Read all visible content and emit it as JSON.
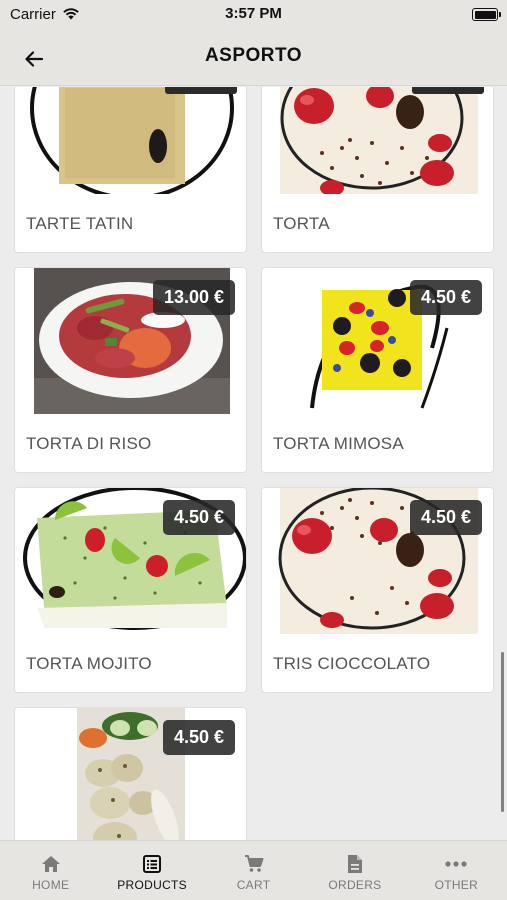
{
  "status_bar": {
    "carrier": "Carrier",
    "time": "3:57 PM"
  },
  "header": {
    "title": "ASPORTO"
  },
  "products": [
    {
      "name": "TARTE TATIN",
      "price": ""
    },
    {
      "name": "TORTA",
      "price": ""
    },
    {
      "name": "TORTA DI RISO",
      "price": "13.00 €"
    },
    {
      "name": "TORTA MIMOSA",
      "price": "4.50 €"
    },
    {
      "name": "TORTA MOJITO",
      "price": "4.50 €"
    },
    {
      "name": "TRIS CIOCCOLATO",
      "price": "4.50 €"
    },
    {
      "name": "",
      "price": "4.50 €"
    }
  ],
  "tabs": [
    {
      "label": "HOME",
      "icon": "home-icon",
      "active": false
    },
    {
      "label": "PRODUCTS",
      "icon": "list-icon",
      "active": true
    },
    {
      "label": "CART",
      "icon": "cart-icon",
      "active": false
    },
    {
      "label": "ORDERS",
      "icon": "document-icon",
      "active": false
    },
    {
      "label": "OTHER",
      "icon": "more-icon",
      "active": false
    }
  ],
  "colors": {
    "bar_background": "#e6e5e2",
    "content_background": "#ececec",
    "badge": "#2b2b2b",
    "active_tab": "#111111",
    "inactive_tab": "#7a7a7a"
  }
}
